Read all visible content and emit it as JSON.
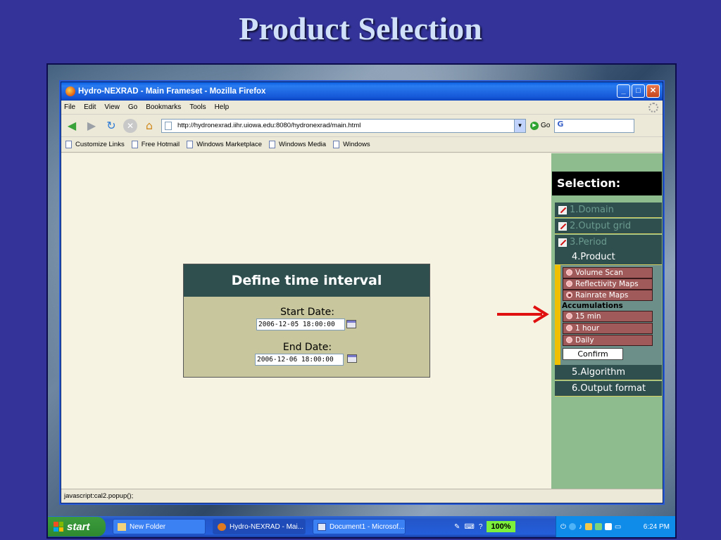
{
  "slide": {
    "title": "Product Selection"
  },
  "window": {
    "title": "Hydro-NEXRAD - Main Frameset - Mozilla Firefox"
  },
  "menu": [
    "File",
    "Edit",
    "View",
    "Go",
    "Bookmarks",
    "Tools",
    "Help"
  ],
  "navbar": {
    "url": "http://hydronexrad.iihr.uiowa.edu:8080/hydronexrad/main.html",
    "go_label": "Go",
    "search_value": ""
  },
  "bookmarks": [
    "Customize Links",
    "Free Hotmail",
    "Windows Marketplace",
    "Windows Media",
    "Windows"
  ],
  "time_interval": {
    "heading": "Define time interval",
    "start_label": "Start Date:",
    "start_value": "2006-12-05 18:00:00",
    "end_label": "End Date:",
    "end_value": "2006-12-06 18:00:00"
  },
  "sidebar": {
    "heading": "Selection:",
    "steps": [
      "1.Domain",
      "2.Output grid",
      "3.Period",
      "4.Product",
      "5.Algorithm",
      "6.Output format"
    ],
    "products": [
      "Volume Scan",
      "Reflectivity Maps",
      "Rainrate Maps"
    ],
    "selected_product": "Rainrate Maps",
    "accumulations_label": "Accumulations",
    "accumulations": [
      "15 min",
      "1 hour",
      "Daily"
    ],
    "confirm_label": "Confirm"
  },
  "status": {
    "text": "javascript:cal2.popup();"
  },
  "taskbar": {
    "start_label": "start",
    "tasks": [
      "New Folder",
      "Hydro-NEXRAD - Mai...",
      "Document1 - Microsof..."
    ],
    "zoom": "100%",
    "clock": "6:24 PM"
  },
  "colors": {
    "accent": "#2f4f4f",
    "option": "#a15a5a",
    "arrow": "#e01010"
  }
}
